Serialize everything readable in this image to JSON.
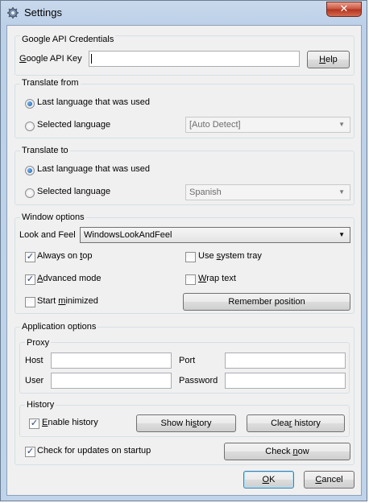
{
  "window": {
    "title": "Settings",
    "close_glyph": "✕"
  },
  "credentials": {
    "legend": "Google API Credentials",
    "key_label": "Google API Key",
    "key_value": "",
    "help_button": "Help"
  },
  "translate_from": {
    "legend": "Translate from",
    "last_used_label": "Last language that was used",
    "selected_label": "Selected language",
    "selected_value": "[Auto Detect]",
    "last_used_checked": true
  },
  "translate_to": {
    "legend": "Translate to",
    "last_used_label": "Last language that was used",
    "selected_label": "Selected language",
    "selected_value": "Spanish",
    "last_used_checked": true
  },
  "window_options": {
    "legend": "Window options",
    "look_feel_label": "Look and Feel",
    "look_feel_value": "WindowsLookAndFeel",
    "always_on_top": "Always on top",
    "use_system_tray": "Use system tray",
    "advanced_mode": "Advanced mode",
    "wrap_text": "Wrap text",
    "start_minimized": "Start minimized",
    "remember_position": "Remember position",
    "always_on_top_checked": true,
    "use_system_tray_checked": false,
    "advanced_mode_checked": true,
    "wrap_text_checked": false,
    "start_minimized_checked": false
  },
  "application_options": {
    "legend": "Application options",
    "proxy": {
      "legend": "Proxy",
      "host_label": "Host",
      "port_label": "Port",
      "user_label": "User",
      "password_label": "Password",
      "host_value": "",
      "port_value": "",
      "user_value": "",
      "password_value": ""
    },
    "history": {
      "legend": "History",
      "enable_label": "Enable history",
      "enable_checked": true,
      "show_button": "Show history",
      "clear_button": "Clear history"
    },
    "check_updates_label": "Check for updates on startup",
    "check_updates_checked": true,
    "check_now_button": "Check now"
  },
  "footer": {
    "ok_button": "OK",
    "cancel_button": "Cancel"
  },
  "check_glyph": "✓"
}
